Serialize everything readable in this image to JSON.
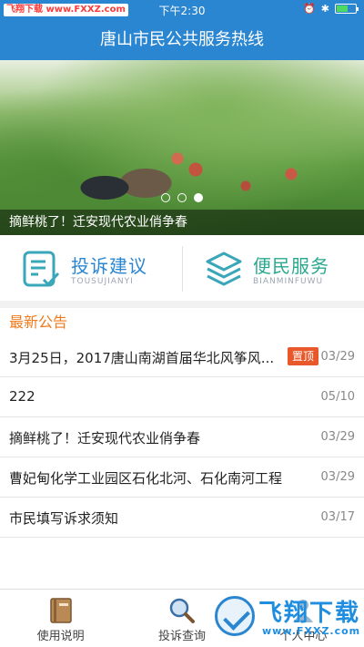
{
  "statusbar": {
    "carrier": "飞翔下载 www.FXXZ.com",
    "time": "下午2:30"
  },
  "navbar": {
    "title": "唐山市民公共服务热线"
  },
  "banner": {
    "caption": "摘鲜桃了！迁安现代农业俏争春",
    "slide_count": 3,
    "active_slide": 3
  },
  "quick": {
    "complaint": {
      "title": "投诉建议",
      "sub": "TOUSUJIANYI"
    },
    "service": {
      "title": "便民服务",
      "sub": "BIANMINFUWU"
    }
  },
  "notices": {
    "header": "最新公告",
    "items": [
      {
        "text": "3月25日，2017唐山南湖首届华北风筝风...",
        "badge": "置顶",
        "date": "03/29"
      },
      {
        "text": "222",
        "date": "05/10"
      },
      {
        "text": "摘鲜桃了！迁安现代农业俏争春",
        "date": "03/29"
      },
      {
        "text": "曹妃甸化学工业园区石化北河、石化南河工程",
        "date": "03/29"
      },
      {
        "text": "市民填写诉求须知",
        "date": "03/17"
      }
    ]
  },
  "tabbar": {
    "tabs": [
      {
        "label": "使用说明",
        "icon": "book-icon"
      },
      {
        "label": "投诉查询",
        "icon": "search-icon"
      },
      {
        "label": "个人中心",
        "icon": "person-icon"
      }
    ]
  },
  "watermark": {
    "title": "飞翔下载",
    "url": "www.FXXZ.com"
  },
  "colors": {
    "primary": "#2b86d2",
    "accent": "#f07a1c",
    "badge": "#e8582a",
    "teal": "#3aa6b9"
  }
}
